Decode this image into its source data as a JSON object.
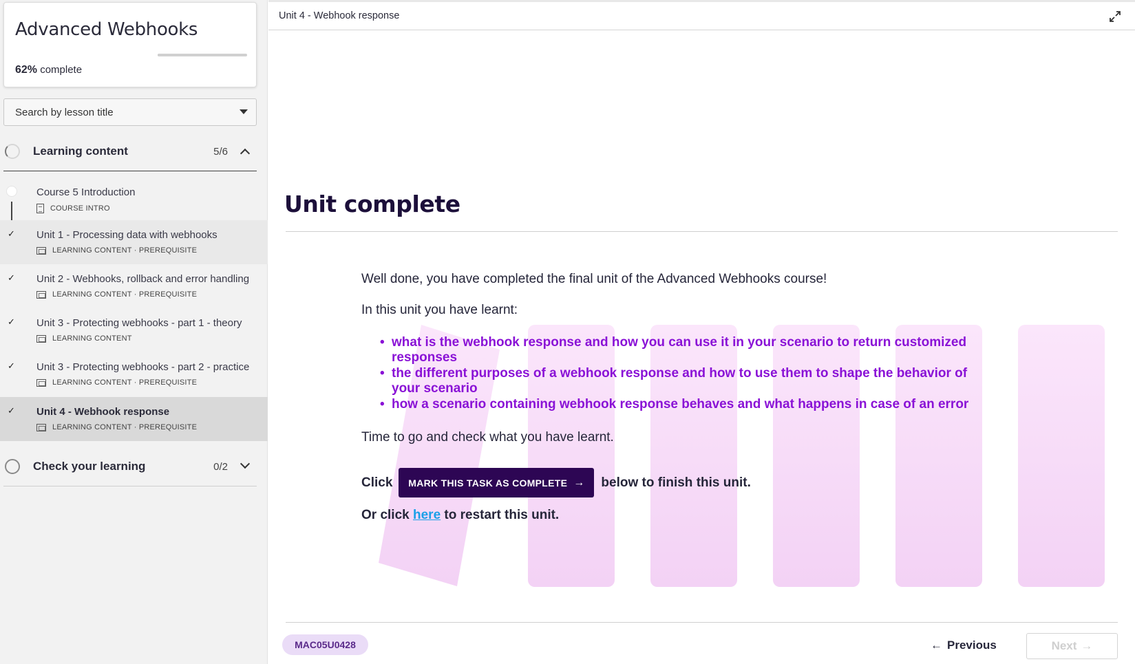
{
  "sidebar": {
    "course_title": "Advanced Webhooks",
    "progress_percent": "62%",
    "progress_value": 0.62,
    "progress_suffix": "complete",
    "search_placeholder": "Search by lesson title",
    "sections": [
      {
        "title": "Learning content",
        "count": "5/6",
        "expanded": true,
        "lessons": [
          {
            "title": "Course 5 Introduction",
            "meta": "COURSE INTRO",
            "completed": false
          },
          {
            "title": "Unit 1 - Processing data with webhooks",
            "meta": "LEARNING CONTENT · PREREQUISITE",
            "completed": true
          },
          {
            "title": "Unit 2 - Webhooks, rollback and error handling",
            "meta": "LEARNING CONTENT · PREREQUISITE",
            "completed": true
          },
          {
            "title": "Unit 3 - Protecting webhooks - part 1 - theory",
            "meta": "LEARNING CONTENT",
            "completed": true
          },
          {
            "title": "Unit 3 - Protecting webhooks - part 2 - practice",
            "meta": "LEARNING CONTENT · PREREQUISITE",
            "completed": true
          },
          {
            "title": "Unit 4 - Webhook response",
            "meta": "LEARNING CONTENT · PREREQUISITE",
            "completed": true
          }
        ]
      },
      {
        "title": "Check your learning",
        "count": "0/2",
        "expanded": false
      }
    ]
  },
  "topbar": {
    "title": "Unit 4 - Webhook response"
  },
  "main": {
    "heading": "Unit complete",
    "intro": "Well done, you have completed the final unit of the Advanced Webhooks course!",
    "learnt_label": "In this unit you have learnt:",
    "bullets": [
      "what is the webhook response and how you can use it in your scenario to return customized responses",
      "the different purposes of a webhook response and how to use them to shape the behavior of your scenario",
      "how a scenario containing webhook response behaves and what happens in case of an error"
    ],
    "time_to_check": "Time to go and check what you have learnt.",
    "click_prefix": "Click",
    "mark_button": "MARK THIS TASK AS COMPLETE",
    "click_suffix": "below to finish this unit.",
    "restart_prefix": "Or click",
    "restart_link": "here",
    "restart_suffix": "to restart this unit."
  },
  "footer": {
    "unit_code": "MAC05U0428",
    "previous_label": "Previous",
    "next_label": "Next"
  },
  "colors": {
    "accent_dark": "#2d0654",
    "bullet_purple": "#8a12d6",
    "link_blue": "#1aa0e8",
    "deco_pink": "#f6d6f7"
  },
  "icons": [
    "expand-icon",
    "check-icon",
    "chevron-up-icon",
    "chevron-down-icon",
    "caret-down-icon",
    "arrow-right-icon",
    "arrow-left-icon",
    "course-intro-icon",
    "learning-content-icon"
  ]
}
